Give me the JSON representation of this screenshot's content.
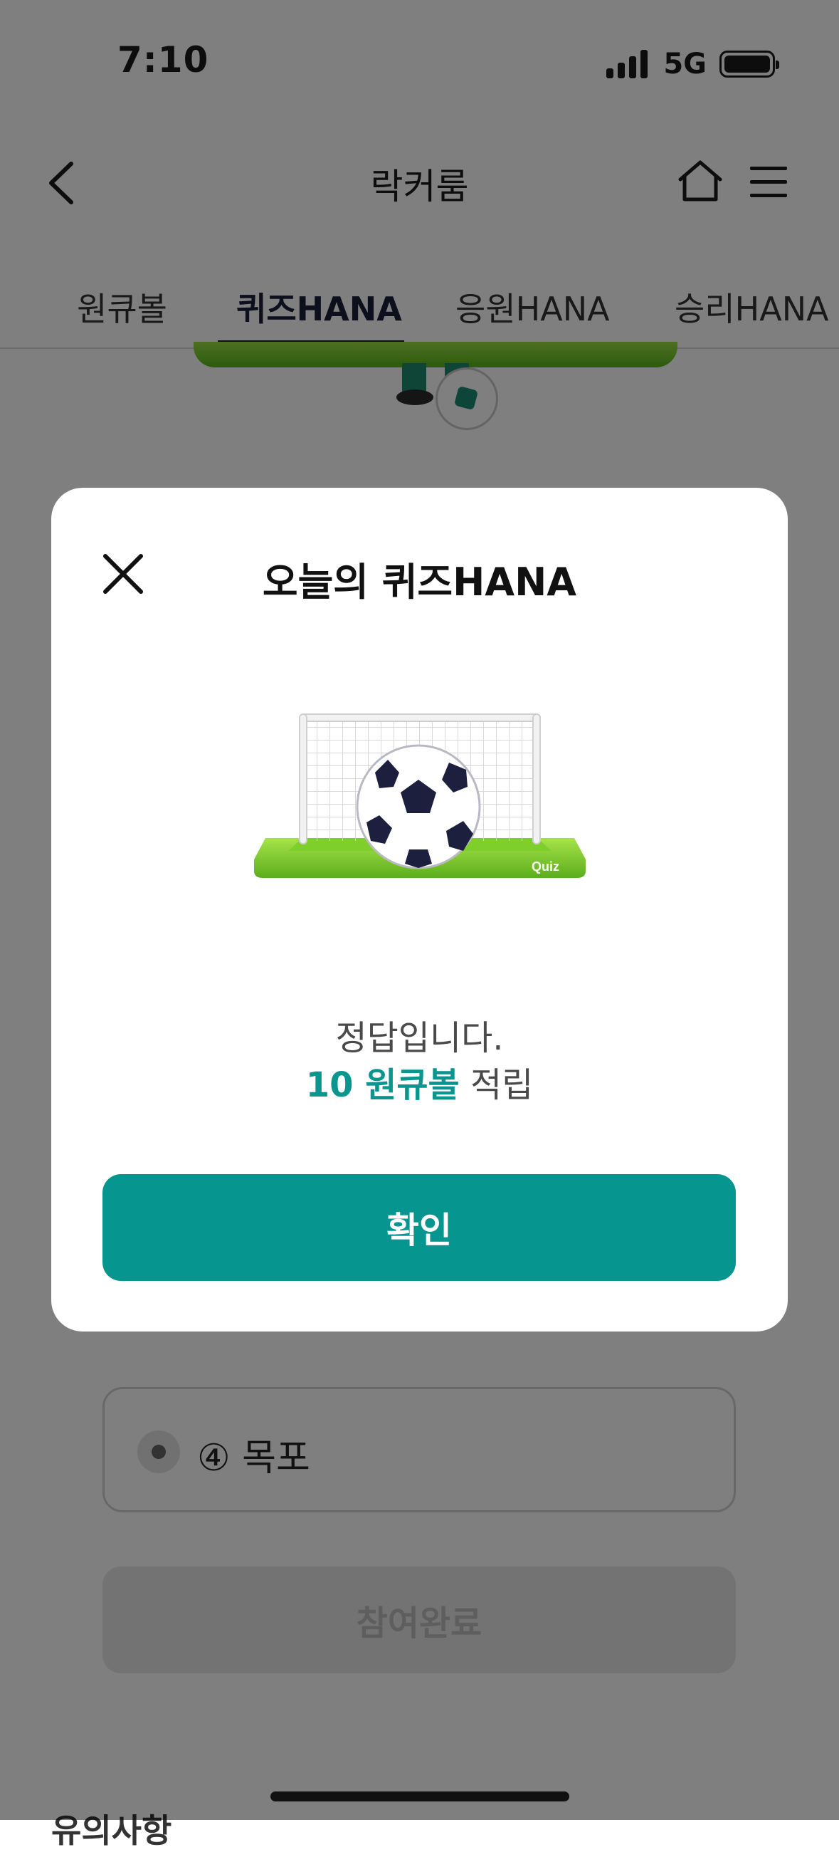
{
  "status_bar": {
    "time": "7:10",
    "network": "5G"
  },
  "nav": {
    "title": "락커룸"
  },
  "tabs": [
    {
      "label": "원큐볼",
      "active": false
    },
    {
      "label": "퀴즈HANA",
      "active": true
    },
    {
      "label": "응원HANA",
      "active": false
    },
    {
      "label": "승리HANA",
      "active": false
    }
  ],
  "quiz": {
    "options": [
      {
        "label": ""
      },
      {
        "label": "④ 목포"
      }
    ],
    "submit_label": "참여완료"
  },
  "notice": {
    "label": "유의사항"
  },
  "modal": {
    "title": "오늘의 퀴즈HANA",
    "illustration_badge": "Quiz",
    "message": "정답입니다.",
    "reward_amount": "10 원큐볼",
    "reward_suffix": " 적립",
    "confirm_label": "확인"
  },
  "colors": {
    "accent": "#07958f",
    "tab_active": "#1b1f3b"
  },
  "icons": [
    "back-icon",
    "home-icon",
    "menu-icon",
    "close-icon",
    "soccer-ball-icon",
    "goal-icon"
  ]
}
